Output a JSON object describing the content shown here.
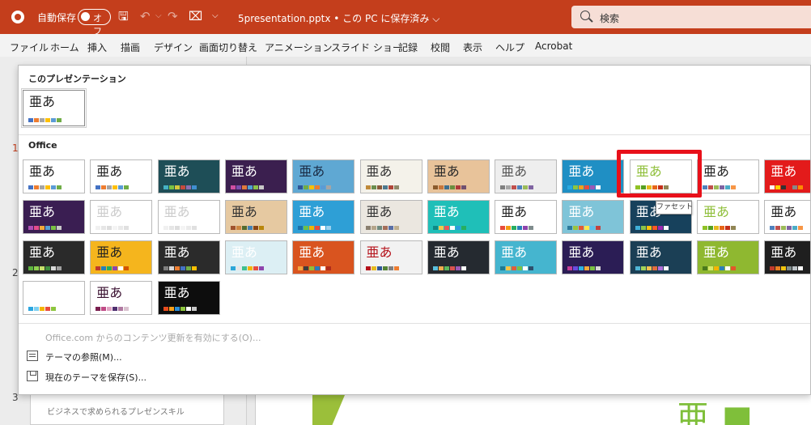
{
  "titlebar": {
    "autosave_label": "自動保存",
    "autosave_state": "オフ",
    "doc_title": "5presentation.pptx • この PC に保存済み ⌵",
    "search_placeholder": "検索",
    "qat_icons": [
      "save-icon",
      "undo-icon",
      "redo-icon",
      "present-icon",
      "customize-icon"
    ]
  },
  "ribbon_tabs": [
    "ファイル",
    "ホーム",
    "挿入",
    "描画",
    "デザイン",
    "画面切り替え",
    "アニメーション",
    "スライド ショー",
    "記録",
    "校閲",
    "表示",
    "ヘルプ",
    "Acrobat"
  ],
  "active_tab": "デザイン",
  "background": {
    "slide_numbers": [
      "1",
      "2",
      "3"
    ],
    "thumb_text": "ビジネスで求められるプレゼンスキル"
  },
  "gallery": {
    "section_this_presentation": "このプレゼンテーション",
    "section_office": "Office",
    "sample_char": "亜あ",
    "tooltip": "ファセット",
    "highlighted_theme": "ファセット",
    "menu": {
      "enable_updates": "Office.com からのコンテンツ更新を有効にする(O)...",
      "browse": "テーマの参照(M)...",
      "save_theme": "現在のテーマを保存(S)..."
    },
    "current_theme": {
      "bg": "#ffffff",
      "fg": "#222222",
      "colors": [
        "#4472c4",
        "#ed7d31",
        "#a5a5a5",
        "#ffc000",
        "#5b9bd5",
        "#70ad47"
      ]
    },
    "themes": [
      {
        "bg": "#ffffff",
        "fg": "#222222",
        "colors": [
          "#4472c4",
          "#ed7d31",
          "#a5a5a5",
          "#ffc000",
          "#5b9bd5",
          "#70ad47"
        ]
      },
      {
        "bg": "#ffffff",
        "fg": "#222222",
        "colors": [
          "#4472c4",
          "#ed7d31",
          "#a5a5a5",
          "#ffc000",
          "#5b9bd5",
          "#70ad47"
        ]
      },
      {
        "bg": "#1e4e57",
        "fg": "#ffffff",
        "colors": [
          "#45b1c4",
          "#7ac143",
          "#d4c73c",
          "#c54a3c",
          "#8a6fb3",
          "#3f8fd1"
        ]
      },
      {
        "bg": "#3b1f4f",
        "fg": "#ffffff",
        "colors": [
          "#d14fa2",
          "#7b4fb0",
          "#e07b3c",
          "#4fa0d1",
          "#8cc04a",
          "#c8c8c8"
        ]
      },
      {
        "bg": "#5fa8d3",
        "fg": "#1b2b44",
        "colors": [
          "#2f5597",
          "#70ad47",
          "#ffc000",
          "#ed7d31",
          "#5b9bd5",
          "#a5a5a5"
        ]
      },
      {
        "bg": "#f4f2ea",
        "fg": "#333333",
        "colors": [
          "#c08a3a",
          "#6b8e4e",
          "#8a5a3a",
          "#4e7a8e",
          "#b0463a",
          "#8e8a6b"
        ]
      },
      {
        "bg": "#e8c39a",
        "fg": "#2a2a2a",
        "colors": [
          "#8b5a2b",
          "#c7763b",
          "#3f6e8e",
          "#6a8e3f",
          "#b03a3a",
          "#705070"
        ]
      },
      {
        "bg": "#eeeeee",
        "fg": "#555555",
        "colors": [
          "#7f7f7f",
          "#a6a6a6",
          "#c0504d",
          "#4f81bd",
          "#9bbb59",
          "#8064a2"
        ]
      },
      {
        "bg": "#1f8fc4",
        "fg": "#ffffff",
        "colors": [
          "#28a9e0",
          "#8dc63f",
          "#f6a01a",
          "#e84c3d",
          "#9b59b6",
          "#ffffff"
        ]
      },
      {
        "bg": "#ffffff",
        "fg": "#8fbf3a",
        "colors": [
          "#90c226",
          "#54a021",
          "#e6b91e",
          "#e76618",
          "#c42f1a",
          "#918655"
        ]
      },
      {
        "bg": "#ffffff",
        "fg": "#222222",
        "colors": [
          "#4f81bd",
          "#c0504d",
          "#9bbb59",
          "#8064a2",
          "#4bacc6",
          "#f79646"
        ]
      },
      {
        "bg": "#e31b1b",
        "fg": "#ffffff",
        "colors": [
          "#ffffff",
          "#ffd200",
          "#333333",
          "#e31b1b",
          "#888888",
          "#ff8a00"
        ]
      },
      {
        "bg": "#3a1e52",
        "fg": "#ffffff",
        "colors": [
          "#b04fb5",
          "#e44c8c",
          "#f2a93b",
          "#56a0d3",
          "#7ac143",
          "#c8c8c8"
        ]
      },
      {
        "bg": "#ffffff",
        "fg": "#cccccc",
        "colors": [
          "#f0f0f0",
          "#e6e6e6",
          "#dddddd",
          "#f4f4f4",
          "#eaeaea",
          "#e0e0e0"
        ]
      },
      {
        "bg": "#ffffff",
        "fg": "#cccccc",
        "colors": [
          "#f0f0f0",
          "#e6e6e6",
          "#dddddd",
          "#f4f4f4",
          "#eaeaea",
          "#e0e0e0"
        ]
      },
      {
        "bg": "#e6c9a1",
        "fg": "#333333",
        "colors": [
          "#a0522d",
          "#cd853f",
          "#556b2f",
          "#4682b4",
          "#8b4513",
          "#b8860b"
        ]
      },
      {
        "bg": "#2e9fd6",
        "fg": "#ffffff",
        "colors": [
          "#1b6fa8",
          "#6cc04a",
          "#f4b400",
          "#e84c3d",
          "#ffffff",
          "#9bd1ee"
        ]
      },
      {
        "bg": "#ebe7e0",
        "fg": "#333333",
        "colors": [
          "#8a7f6f",
          "#b5a58a",
          "#6f8a7f",
          "#a56f5a",
          "#5a6fa5",
          "#c0b090"
        ]
      },
      {
        "bg": "#1fbfb8",
        "fg": "#ffffff",
        "colors": [
          "#0e8a85",
          "#f2c94c",
          "#eb5757",
          "#ffffff",
          "#2d9cdb",
          "#27ae60"
        ]
      },
      {
        "bg": "#ffffff",
        "fg": "#222222",
        "colors": [
          "#e84c3d",
          "#f39c12",
          "#27ae60",
          "#2980b9",
          "#8e44ad",
          "#7f8c8d"
        ]
      },
      {
        "bg": "#7fc4d8",
        "fg": "#ffffff",
        "colors": [
          "#2c7a9b",
          "#9bc53d",
          "#e55934",
          "#fde74c",
          "#5bc0eb",
          "#c3423f"
        ]
      },
      {
        "bg": "#17415c",
        "fg": "#ffffff",
        "colors": [
          "#3fb0d9",
          "#8bc34a",
          "#ffc107",
          "#ff5722",
          "#9c27b0",
          "#ffffff"
        ]
      },
      {
        "bg": "#ffffff",
        "fg": "#8fbf3a",
        "colors": [
          "#90c226",
          "#54a021",
          "#e6b91e",
          "#e76618",
          "#c42f1a",
          "#918655"
        ]
      },
      {
        "bg": "#ffffff",
        "fg": "#222222",
        "colors": [
          "#4f81bd",
          "#c0504d",
          "#9bbb59",
          "#8064a2",
          "#4bacc6",
          "#f79646"
        ]
      },
      {
        "bg": "#2a2a2a",
        "fg": "#ffffff",
        "colors": [
          "#5db33f",
          "#8fd14f",
          "#c6e06a",
          "#3f8f3f",
          "#d9d9d9",
          "#a0a0a0"
        ]
      },
      {
        "bg": "#f5b51d",
        "fg": "#222222",
        "colors": [
          "#c0392b",
          "#2980b9",
          "#27ae60",
          "#8e44ad",
          "#ffffff",
          "#d35400"
        ]
      },
      {
        "bg": "#2b2b2b",
        "fg": "#ffffff",
        "colors": [
          "#7f7f7f",
          "#d9d9d9",
          "#ed7d31",
          "#4472c4",
          "#70ad47",
          "#ffc000"
        ]
      },
      {
        "bg": "#dceff4",
        "fg": "#ffffff",
        "colors": [
          "#2ca6d8",
          "#e6e6e6",
          "#3fbf8f",
          "#f4b400",
          "#e84c3d",
          "#8e44ad"
        ]
      },
      {
        "bg": "#d9541f",
        "fg": "#ffffff",
        "colors": [
          "#f2a541",
          "#3d3d3d",
          "#8fbf3a",
          "#2b7bb9",
          "#ffffff",
          "#b02c1c"
        ]
      },
      {
        "bg": "#f2f2f2",
        "fg": "#b5121b",
        "colors": [
          "#b5121b",
          "#e6b91e",
          "#2f5597",
          "#548235",
          "#7f7f7f",
          "#ed7d31"
        ]
      },
      {
        "bg": "#252a30",
        "fg": "#ffffff",
        "colors": [
          "#5bc0de",
          "#f0ad4e",
          "#5cb85c",
          "#d9534f",
          "#9b59b6",
          "#ffffff"
        ]
      },
      {
        "bg": "#45b5cf",
        "fg": "#ffffff",
        "colors": [
          "#1f7a91",
          "#f6c445",
          "#e05d3a",
          "#7ac143",
          "#ffffff",
          "#2d4f6c"
        ]
      },
      {
        "bg": "#2b1d55",
        "fg": "#ffffff",
        "colors": [
          "#c63d96",
          "#6a4ce0",
          "#2fb3e0",
          "#f2a93b",
          "#7ac143",
          "#d6d6d6"
        ]
      },
      {
        "bg": "#1b3f55",
        "fg": "#ffffff",
        "colors": [
          "#4fb6d6",
          "#a3d45a",
          "#f2c14e",
          "#e06c3d",
          "#b06cd9",
          "#ffffff"
        ]
      },
      {
        "bg": "#8fb830",
        "fg": "#ffffff",
        "colors": [
          "#4a7a1c",
          "#d6e96a",
          "#f4b400",
          "#2d7fb9",
          "#ffffff",
          "#e2572a"
        ]
      },
      {
        "bg": "#1f1f1f",
        "fg": "#ffffff",
        "colors": [
          "#c0392b",
          "#e67e22",
          "#f1c40f",
          "#7f8c8d",
          "#bdc3c7",
          "#ffffff"
        ]
      },
      {
        "bg": "#ffffff",
        "fg": "#ffffff",
        "colors": [
          "#2ca6e0",
          "#7fd0f0",
          "#f4b400",
          "#e84c3d",
          "#8dc63f",
          "#ffffff"
        ]
      },
      {
        "bg": "#ffffff",
        "fg": "#3a1030",
        "colors": [
          "#7a1f4f",
          "#c04a86",
          "#e0a3c2",
          "#4f2f6f",
          "#b07aa1",
          "#d9c2cf"
        ]
      },
      {
        "bg": "#0d0d0d",
        "fg": "#ffffff",
        "colors": [
          "#e84c1e",
          "#f6a01a",
          "#2b8fd8",
          "#8dc63f",
          "#ffffff",
          "#c8c8c8"
        ]
      }
    ]
  }
}
